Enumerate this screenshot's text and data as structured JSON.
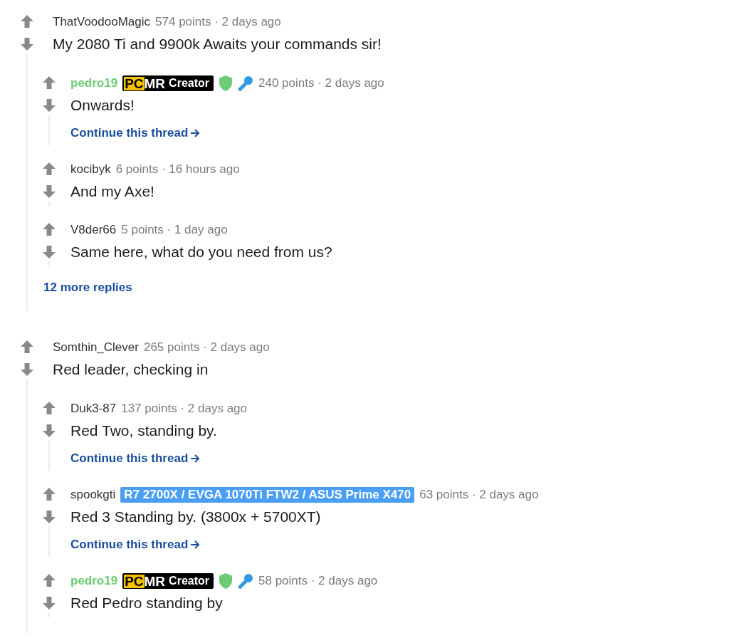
{
  "comments": [
    {
      "author": "ThatVoodooMagic",
      "op": false,
      "meta": "574 points · 2 days ago",
      "body": "My 2080 Ti and 9900k Awaits your commands sir!",
      "children": [
        {
          "author": "pedro19",
          "op": true,
          "flair": {
            "kind": "logo",
            "mark": "PC",
            "logo": "MR",
            "text": "Creator"
          },
          "moderator": true,
          "speaker": true,
          "meta": "240 points · 2 days ago",
          "body": "Onwards!",
          "continue": "Continue this thread"
        },
        {
          "author": "kocibyk",
          "op": false,
          "meta": "6 points · 16 hours ago",
          "body": "And my Axe!"
        },
        {
          "author": "V8der66",
          "op": false,
          "meta": "5 points · 1 day ago",
          "body": "Same here, what do you need from us?"
        }
      ],
      "more": "12 more replies"
    },
    {
      "author": "Somthin_Clever",
      "op": false,
      "meta": "265 points · 2 days ago",
      "body": "Red leader, checking in",
      "children": [
        {
          "author": "Duk3-87",
          "op": false,
          "meta": "137 points · 2 days ago",
          "body": "Red Two, standing by.",
          "continue": "Continue this thread"
        },
        {
          "author": "spookgti",
          "op": false,
          "flair": {
            "kind": "text",
            "text": "R7 2700X / EVGA 1070Ti FTW2 / ASUS Prime X470"
          },
          "meta": "63 points · 2 days ago",
          "body": "Red 3 Standing by. (3800x + 5700XT)",
          "continue": "Continue this thread"
        },
        {
          "author": "pedro19",
          "op": true,
          "flair": {
            "kind": "logo",
            "mark": "PC",
            "logo": "MR",
            "text": "Creator"
          },
          "moderator": true,
          "speaker": true,
          "meta": "58 points · 2 days ago",
          "body": "Red Pedro standing by"
        }
      ]
    }
  ]
}
